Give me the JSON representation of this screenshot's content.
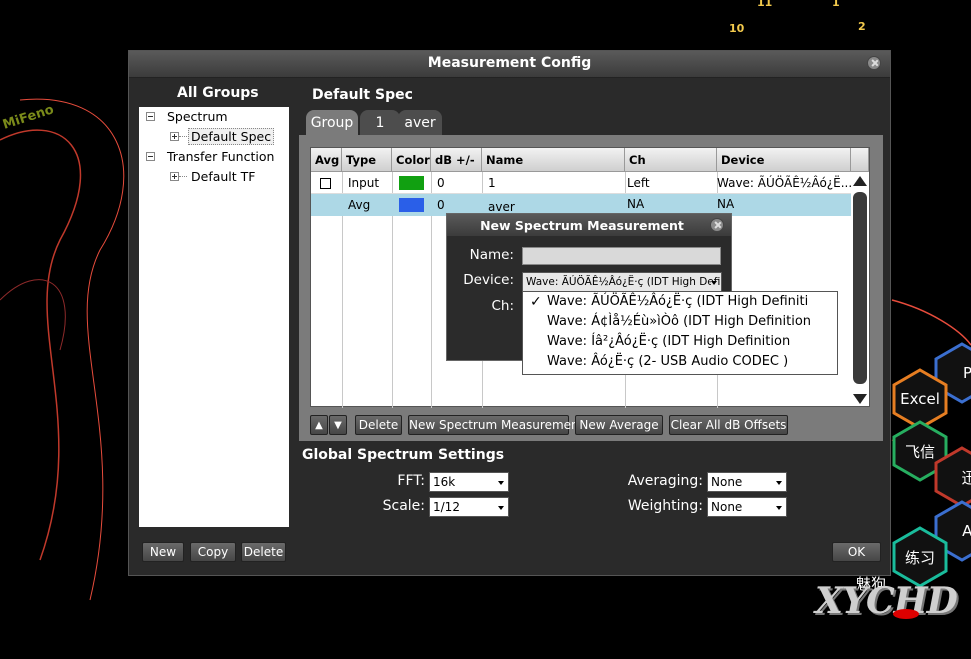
{
  "background": {
    "clock_numbers": [
      "11",
      "1",
      "10",
      "2"
    ],
    "watermark_left": "MiFeno",
    "logo": "XYCHD",
    "tile_labels": [
      "PP",
      "Excel",
      "飞信",
      "迅",
      "Au",
      "练习",
      "魅狗"
    ]
  },
  "window": {
    "title": "Measurement Config",
    "groups_heading": "All Groups",
    "tree": {
      "spectrum": "Spectrum",
      "default_spec": "Default Spec",
      "transfer_function": "Transfer Function",
      "default_tf": "Default TF"
    },
    "left_buttons": {
      "new": "New",
      "copy": "Copy",
      "delete": "Delete"
    },
    "spec_heading": "Default Spec",
    "tabs": [
      {
        "label": "Group"
      },
      {
        "label": "1"
      },
      {
        "label": "aver"
      }
    ],
    "table": {
      "columns": [
        "Avg",
        "Type",
        "Color",
        "dB +/-",
        "Name",
        "Ch",
        "Device"
      ],
      "rows": [
        {
          "avg": "",
          "type": "Input",
          "color": "#11a011",
          "db": "0",
          "name": "1",
          "ch": "Left",
          "device": "Wave: ÃÚÖÃÊ½Âó¿Ë..."
        },
        {
          "avg": "",
          "type": "Avg",
          "color": "#2a5fe8",
          "db": "0",
          "name": "aver",
          "ch": "NA",
          "device": "NA"
        }
      ]
    },
    "table_buttons": {
      "up": "▲",
      "down": "▼",
      "delete": "Delete",
      "new_spectrum": "New Spectrum Measurement",
      "new_average": "New Average",
      "clear_offsets": "Clear All dB Offsets"
    },
    "global_heading": "Global Spectrum Settings",
    "settings": {
      "fft_label": "FFT:",
      "fft_value": "16k",
      "scale_label": "Scale:",
      "scale_value": "1/12",
      "averaging_label": "Averaging:",
      "averaging_value": "None",
      "weighting_label": "Weighting:",
      "weighting_value": "None"
    },
    "ok": "OK"
  },
  "dialog": {
    "title": "New Spectrum Measurement",
    "name_label": "Name:",
    "name_value": "",
    "device_label": "Device:",
    "device_value": "Wave: ÃÚÖÃÊ½Âó¿Ë·ç (IDT High Definiti",
    "ch_label": "Ch:",
    "device_options": [
      {
        "label": "Wave: ÃÚÖÃÊ½Âó¿Ë·ç (IDT High Definiti",
        "checked": "✓"
      },
      {
        "label": "Wave: Á¢Ìå½Éù»ìÒô (IDT High Definition"
      },
      {
        "label": "Wave: Íâ²¿Âó¿Ë·ç (IDT High Definition"
      },
      {
        "label": "Wave: Âó¿Ë·ç (2- USB Audio CODEC )"
      }
    ]
  },
  "colors": {
    "accent_blue": "#add8e6",
    "window_bg": "#2a2a2a"
  }
}
